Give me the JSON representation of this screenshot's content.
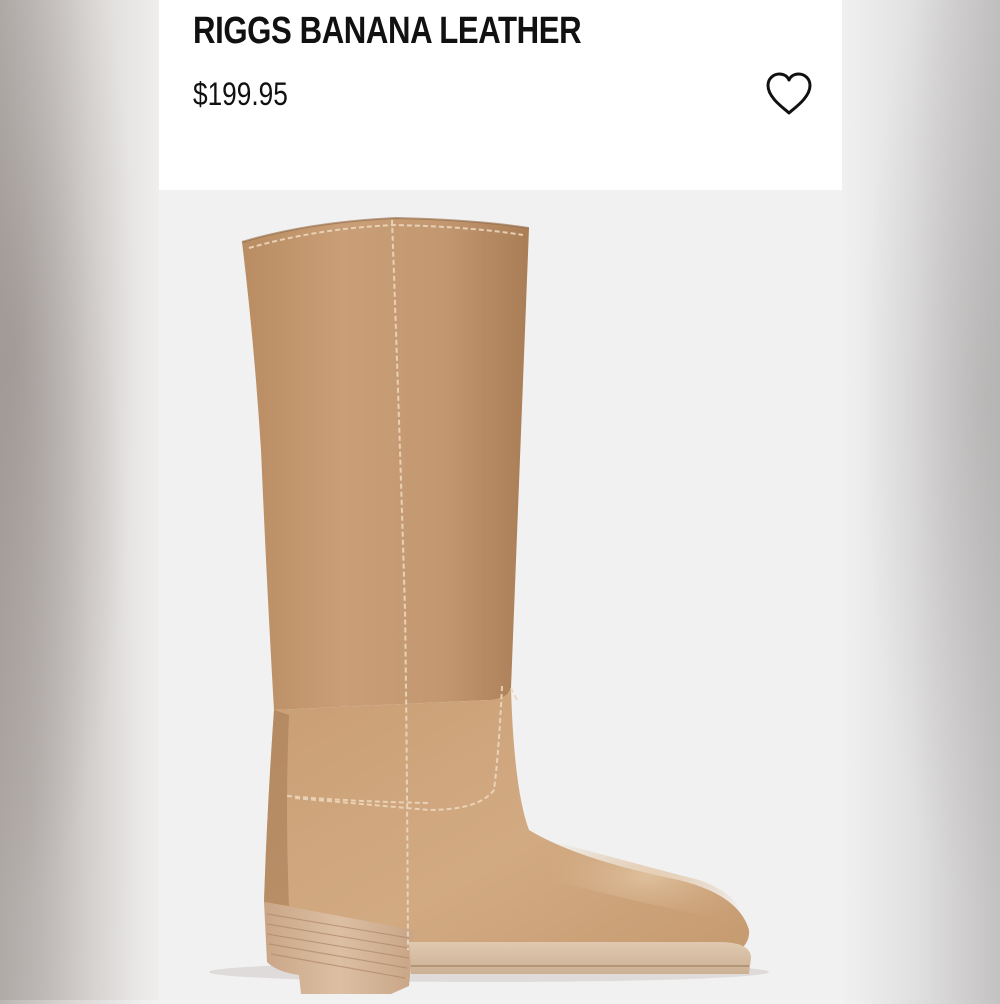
{
  "product": {
    "title": "RIGGS BANANA LEATHER",
    "price": "$199.95",
    "image_alt": "Tall tan leather riding boot with stacked wooden block heel",
    "wishlist_icon": "heart-outline-icon"
  },
  "colors": {
    "header_background": "#ffffff",
    "text": "#111111",
    "image_background": "#f2f1f1",
    "boot_leather": "#c9a078",
    "heel_wood": "#d7b899"
  }
}
